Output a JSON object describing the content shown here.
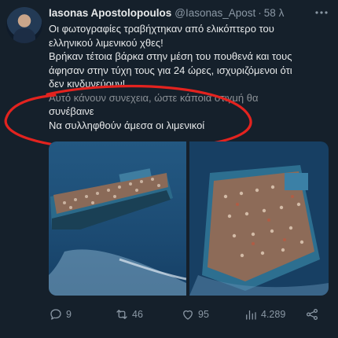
{
  "author": {
    "name": "Iasonas Apostolopoulos",
    "handle": "@Iasonas_Apost",
    "separator": "·",
    "time": "58 λ"
  },
  "tweet": {
    "lines": [
      "Οι φωτογραφίες τραβήχτηκαν από ελικόπτερο του",
      "ελληνικού λιμενικού χθες!",
      "Βρήκαν τέτοια βάρκα στην μέση του πουθενά και τους",
      "άφησαν στην τύχη τους για 24 ώρες, ισχυριζόμενοι ότι",
      "δεν κινδυνεύουν!",
      "Αυτό κάνουν συνεχεια, ώστε κάποια στιγμή θα",
      "συνέβαινε",
      "Να συλληφθούν άμεσα οι λιμενικοί"
    ]
  },
  "more_icon": "more-dots-icon",
  "actions": {
    "reply_count": "9",
    "retweet_count": "46",
    "like_count": "95",
    "views_count": "4.289"
  },
  "colors": {
    "background": "#15202b",
    "text": "#e7e9ea",
    "muted": "#8b98a5",
    "annotation_circle": "#e3231f"
  }
}
